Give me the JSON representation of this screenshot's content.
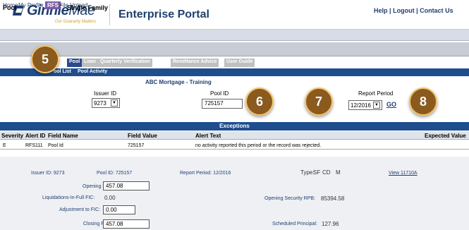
{
  "header": {
    "logo_main": "Ginnie",
    "logo_mae": "Mae",
    "tagline": "Our Guaranty Matters",
    "portal_title": "Enterprise Portal",
    "help": "Help",
    "sep1": "|",
    "logout": "Logout",
    "sep2": "|",
    "contact": "Contact Us"
  },
  "menu": {
    "home": "Home",
    "my_profile": "My Profile",
    "rfs": "RFS",
    "file_upload": "File Upload"
  },
  "pool_bar": {
    "title": "Pool",
    "subtitle": "Single Family"
  },
  "tabs": {
    "pool": "Pool",
    "loan": "Loan",
    "quarterly": "Quarterly Verification",
    "remittance": "Remittance Advice",
    "guide": "User Guide"
  },
  "subnav": {
    "pool_list": "ool List",
    "pool_activity": "Pool Activity"
  },
  "form": {
    "org_name": "ABC Mortgage - Training",
    "issuer_label": "Issuer ID",
    "issuer_value": "9273",
    "pool_label": "Pool ID",
    "pool_value": "725157",
    "period_label": "Report Period",
    "period_value": "12/2016",
    "go": "GO"
  },
  "badges": {
    "b5": "5",
    "b6": "6",
    "b7": "7",
    "b8": "8"
  },
  "exceptions": {
    "title": "Exceptions",
    "columns": [
      "Severity",
      "Alert ID",
      "Field Name",
      "Field Value",
      "Alert Text",
      "Expected Value"
    ],
    "row": [
      "E",
      "RFS111",
      "Pool Id",
      "725157",
      "no activity reported this period or the record was rejected.",
      ""
    ]
  },
  "details": {
    "issuer_id": "Issuer ID: 9273",
    "pool_id": "Pool ID: 725157",
    "report_period": "Report Period: 12/2016",
    "type_label": "Type:",
    "type_sf": "SF",
    "type_cd": "CD",
    "type_m": "M",
    "view_link": "View 11710A",
    "opening_fic_label": "Opening FIC:",
    "opening_fic_value": "457.08",
    "liquidations_label": "Liquidations-In-Full FIC:",
    "liquidations_value": "0.00",
    "opening_rpb_label": "Opening Security RPB:",
    "opening_rpb_value": "85394.58",
    "adjustment_label": "Adjustment to FIC:",
    "adjustment_value": "0.00",
    "closing_fic_label": "Closing FIC:",
    "closing_fic_value": "457.08",
    "scheduled_label": "Scheduled Principal:",
    "scheduled_value": "127.96"
  },
  "colors": {
    "brand_navy": "#1f3f6f",
    "nav_blue": "#1f4e8f",
    "badge_brown": "#8a5a1e",
    "badge_ring": "#f3c56f",
    "rfs_purple": "#7a5ca8"
  }
}
